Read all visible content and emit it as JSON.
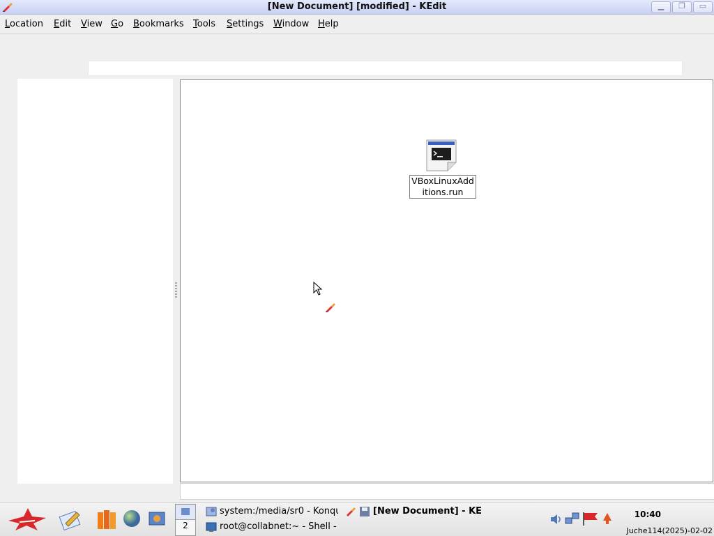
{
  "window": {
    "title": "[New Document] [modified] - KEdit",
    "app_icon": "kedit-brush-icon",
    "buttons": [
      "minimize",
      "maximize",
      "close"
    ]
  },
  "menubar": [
    {
      "label": "Location",
      "accel": "L",
      "rest": "ocation"
    },
    {
      "label": "Edit",
      "accel": "E",
      "rest": "dit"
    },
    {
      "label": "View",
      "accel": "V",
      "rest": "iew"
    },
    {
      "label": "Go",
      "accel": "G",
      "rest": "o"
    },
    {
      "label": "Bookmarks",
      "accel": "B",
      "rest": "ookmarks"
    },
    {
      "label": "Tools",
      "accel": "T",
      "rest": "ools"
    },
    {
      "label": "Settings",
      "accel": "S",
      "rest": "ettings"
    },
    {
      "label": "Window",
      "accel": "W",
      "rest": "indow"
    },
    {
      "label": "Help",
      "accel": "H",
      "rest": "elp"
    }
  ],
  "main": {
    "file_item": {
      "name_line1": "VBoxLinuxAdd",
      "name_line2": "itions.run",
      "icon": "terminal-script-icon"
    }
  },
  "taskbar": {
    "launchers": [
      "kde-menu-icon",
      "text-editor-icon",
      "books-icon",
      "globe-icon",
      "settings-icon"
    ],
    "pager": {
      "desktop1": "",
      "desktop2": "2"
    },
    "tasks": [
      {
        "label": "system:/media/sr0 - Konqu",
        "icon": "konqueror-icon"
      },
      {
        "label": "[New Document] - KE",
        "icon": "kedit-icon"
      },
      {
        "label": "root@collabnet:~ - Shell -",
        "icon": "terminal-icon"
      }
    ],
    "tray": [
      "volume-icon",
      "network-icon",
      "flag-icon",
      "update-icon"
    ],
    "clock": "10:40",
    "date": "Juche114(2025)-02-02"
  },
  "colors": {
    "titlebar_top": "#e4e9fb",
    "titlebar_bottom": "#c9d1f2",
    "background": "#efefef",
    "panel": "#ffffff"
  }
}
